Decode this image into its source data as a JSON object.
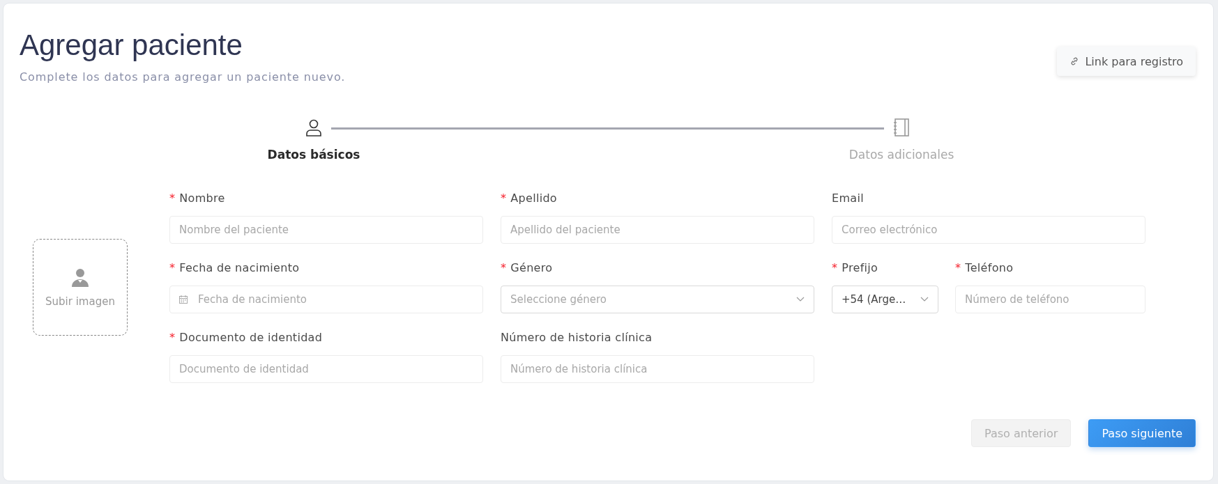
{
  "header": {
    "title": "Agregar paciente",
    "subtitle": "Complete los datos para agregar un paciente nuevo.",
    "link_button": "Link para registro"
  },
  "stepper": [
    {
      "label": "Datos básicos",
      "selected": true
    },
    {
      "label": "Datos adicionales",
      "selected": false
    }
  ],
  "upload": {
    "label": "Subir imagen"
  },
  "form_rows": [
    [
      {
        "kind": "text",
        "required_mark": "*",
        "label": "Nombre",
        "placeholder": "Nombre del paciente"
      },
      {
        "kind": "text",
        "required_mark": "*",
        "label": "Apellido",
        "placeholder": "Apellido del paciente"
      },
      {
        "kind": "text",
        "label": "Email",
        "placeholder": "Correo electrónico"
      }
    ],
    [
      {
        "kind": "date",
        "required_mark": "*",
        "label": "Fecha de nacimiento",
        "placeholder": "Fecha de nacimiento"
      },
      {
        "kind": "select",
        "required_mark": "*",
        "label": "Género",
        "placeholder": "Seleccione género"
      },
      {
        "kind": "pair",
        "fields": [
          {
            "kind": "select",
            "required_mark": "*",
            "label": "Prefijo",
            "value": "+54 (Arge…"
          },
          {
            "kind": "text",
            "required_mark": "*",
            "label": "Teléfono",
            "placeholder": "Número de teléfono"
          }
        ]
      }
    ],
    [
      {
        "kind": "text",
        "required_mark": "*",
        "label": "Documento de identidad",
        "placeholder": "Documento de identidad"
      },
      {
        "kind": "text",
        "label": "Número de historia clínica",
        "placeholder": "Número de historia clínica"
      }
    ]
  ],
  "buttons": [
    {
      "label": "Paso anterior",
      "kind": "secondary",
      "disabled": true
    },
    {
      "label": "Paso siguiente",
      "kind": "primary",
      "disabled": false
    }
  ]
}
